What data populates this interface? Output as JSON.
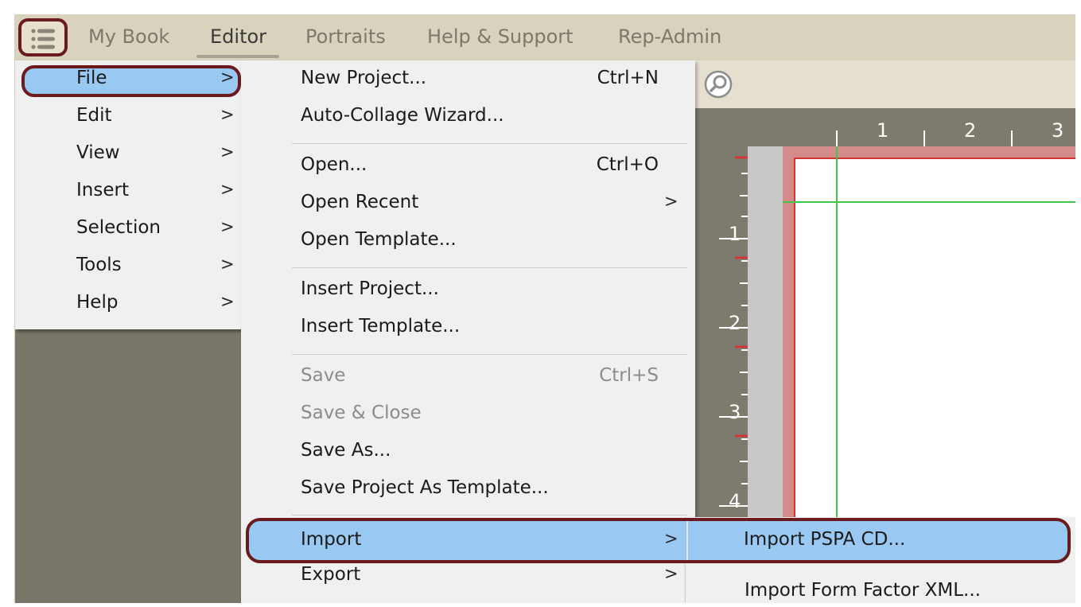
{
  "tabs": [
    {
      "label": "My Book",
      "active": false
    },
    {
      "label": "Editor",
      "active": true
    },
    {
      "label": "Portraits",
      "active": false
    },
    {
      "label": "Help & Support",
      "active": false
    },
    {
      "label": "Rep-Admin",
      "active": false
    }
  ],
  "main_menu": {
    "items": [
      {
        "label": "File",
        "selected": true
      },
      {
        "label": "Edit"
      },
      {
        "label": "View"
      },
      {
        "label": "Insert"
      },
      {
        "label": "Selection"
      },
      {
        "label": "Tools"
      },
      {
        "label": "Help"
      }
    ],
    "arrow": ">"
  },
  "file_menu": {
    "new_project": {
      "label": "New Project...",
      "shortcut": "Ctrl+N"
    },
    "auto_collage": {
      "label": "Auto-Collage Wizard..."
    },
    "open": {
      "label": "Open...",
      "shortcut": "Ctrl+O"
    },
    "open_recent": {
      "label": "Open Recent"
    },
    "open_template": {
      "label": "Open Template..."
    },
    "insert_project": {
      "label": "Insert Project..."
    },
    "insert_template": {
      "label": "Insert Template..."
    },
    "save": {
      "label": "Save",
      "shortcut": "Ctrl+S",
      "disabled": true
    },
    "save_close": {
      "label": "Save & Close",
      "disabled": true
    },
    "save_as": {
      "label": "Save As..."
    },
    "save_project_template": {
      "label": "Save Project As Template..."
    },
    "import": {
      "label": "Import",
      "selected": true
    },
    "export": {
      "label": "Export"
    }
  },
  "import_menu": {
    "items": [
      {
        "label": "Import PSPA CD...",
        "selected": true
      },
      {
        "label": "Import Form Factor XML..."
      }
    ]
  },
  "ruler": {
    "top": [
      "1",
      "2",
      "3"
    ],
    "left": [
      "1",
      "2",
      "3",
      "4"
    ]
  },
  "colors": {
    "highlight": "#99c9f2",
    "callout": "#6b1b1d",
    "toolbar": "#d9d2bd",
    "workspace": "#7a7669",
    "margin_line": "#d23636",
    "guide": "#45c545"
  },
  "icons": {
    "hamburger": "hamburger-menu-icon",
    "zoom": "zoom-icon",
    "submenu": "chevron-right-icon"
  }
}
